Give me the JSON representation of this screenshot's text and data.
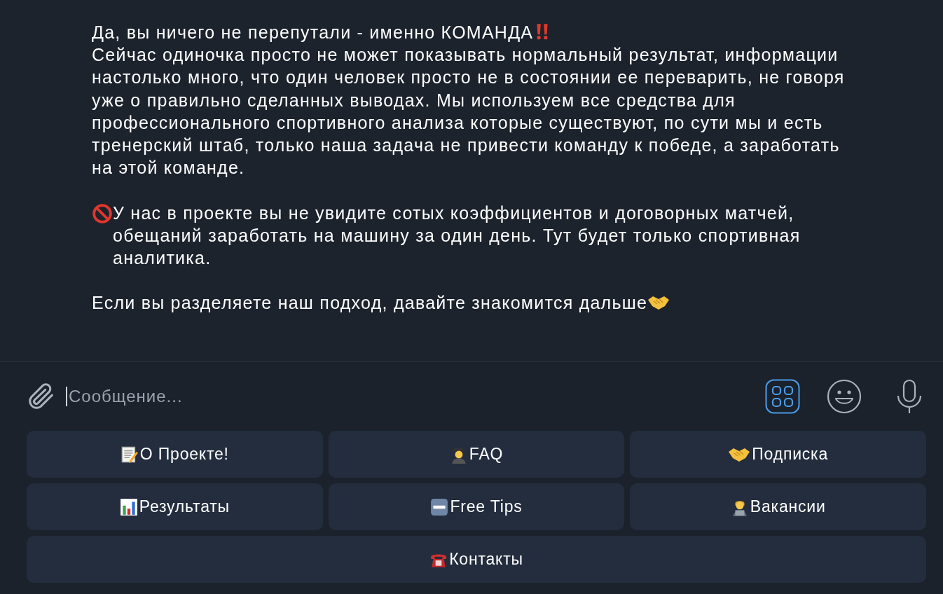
{
  "message": {
    "paragraphs": [
      {
        "lines": [
          "Да, вы ничего не перепутали - именно КОМАНДА",
          "Сейчас одиночка просто не может показывать нормальный результат, информации настолько много, что один человек просто не в состоянии ее переварить, не говоря уже о правильно сделанных выводах. Мы используем все средства для профессионального спортивного анализа которые существуют, по сути мы и есть тренерский штаб, только наша задача не привести команду к победе, а заработать на этой команде."
        ]
      },
      {
        "lines": [
          "У нас в проекте вы не увидите сотых коэффициентов и договорных матчей, обещаний заработать на машину за один день. Тут будет только спортивная аналитика."
        ]
      },
      {
        "lines": [
          "Если вы разделяете наш подход, давайте знакомится дальше"
        ]
      }
    ]
  },
  "composer": {
    "placeholder": "Сообщение..."
  },
  "keyboard": {
    "buttons": [
      {
        "label": "О Проекте!"
      },
      {
        "label": "FAQ"
      },
      {
        "label": "Подписка"
      },
      {
        "label": "Результаты"
      },
      {
        "label": "Free Tips"
      },
      {
        "label": "Вакансии"
      },
      {
        "label": "Контакты"
      }
    ]
  }
}
